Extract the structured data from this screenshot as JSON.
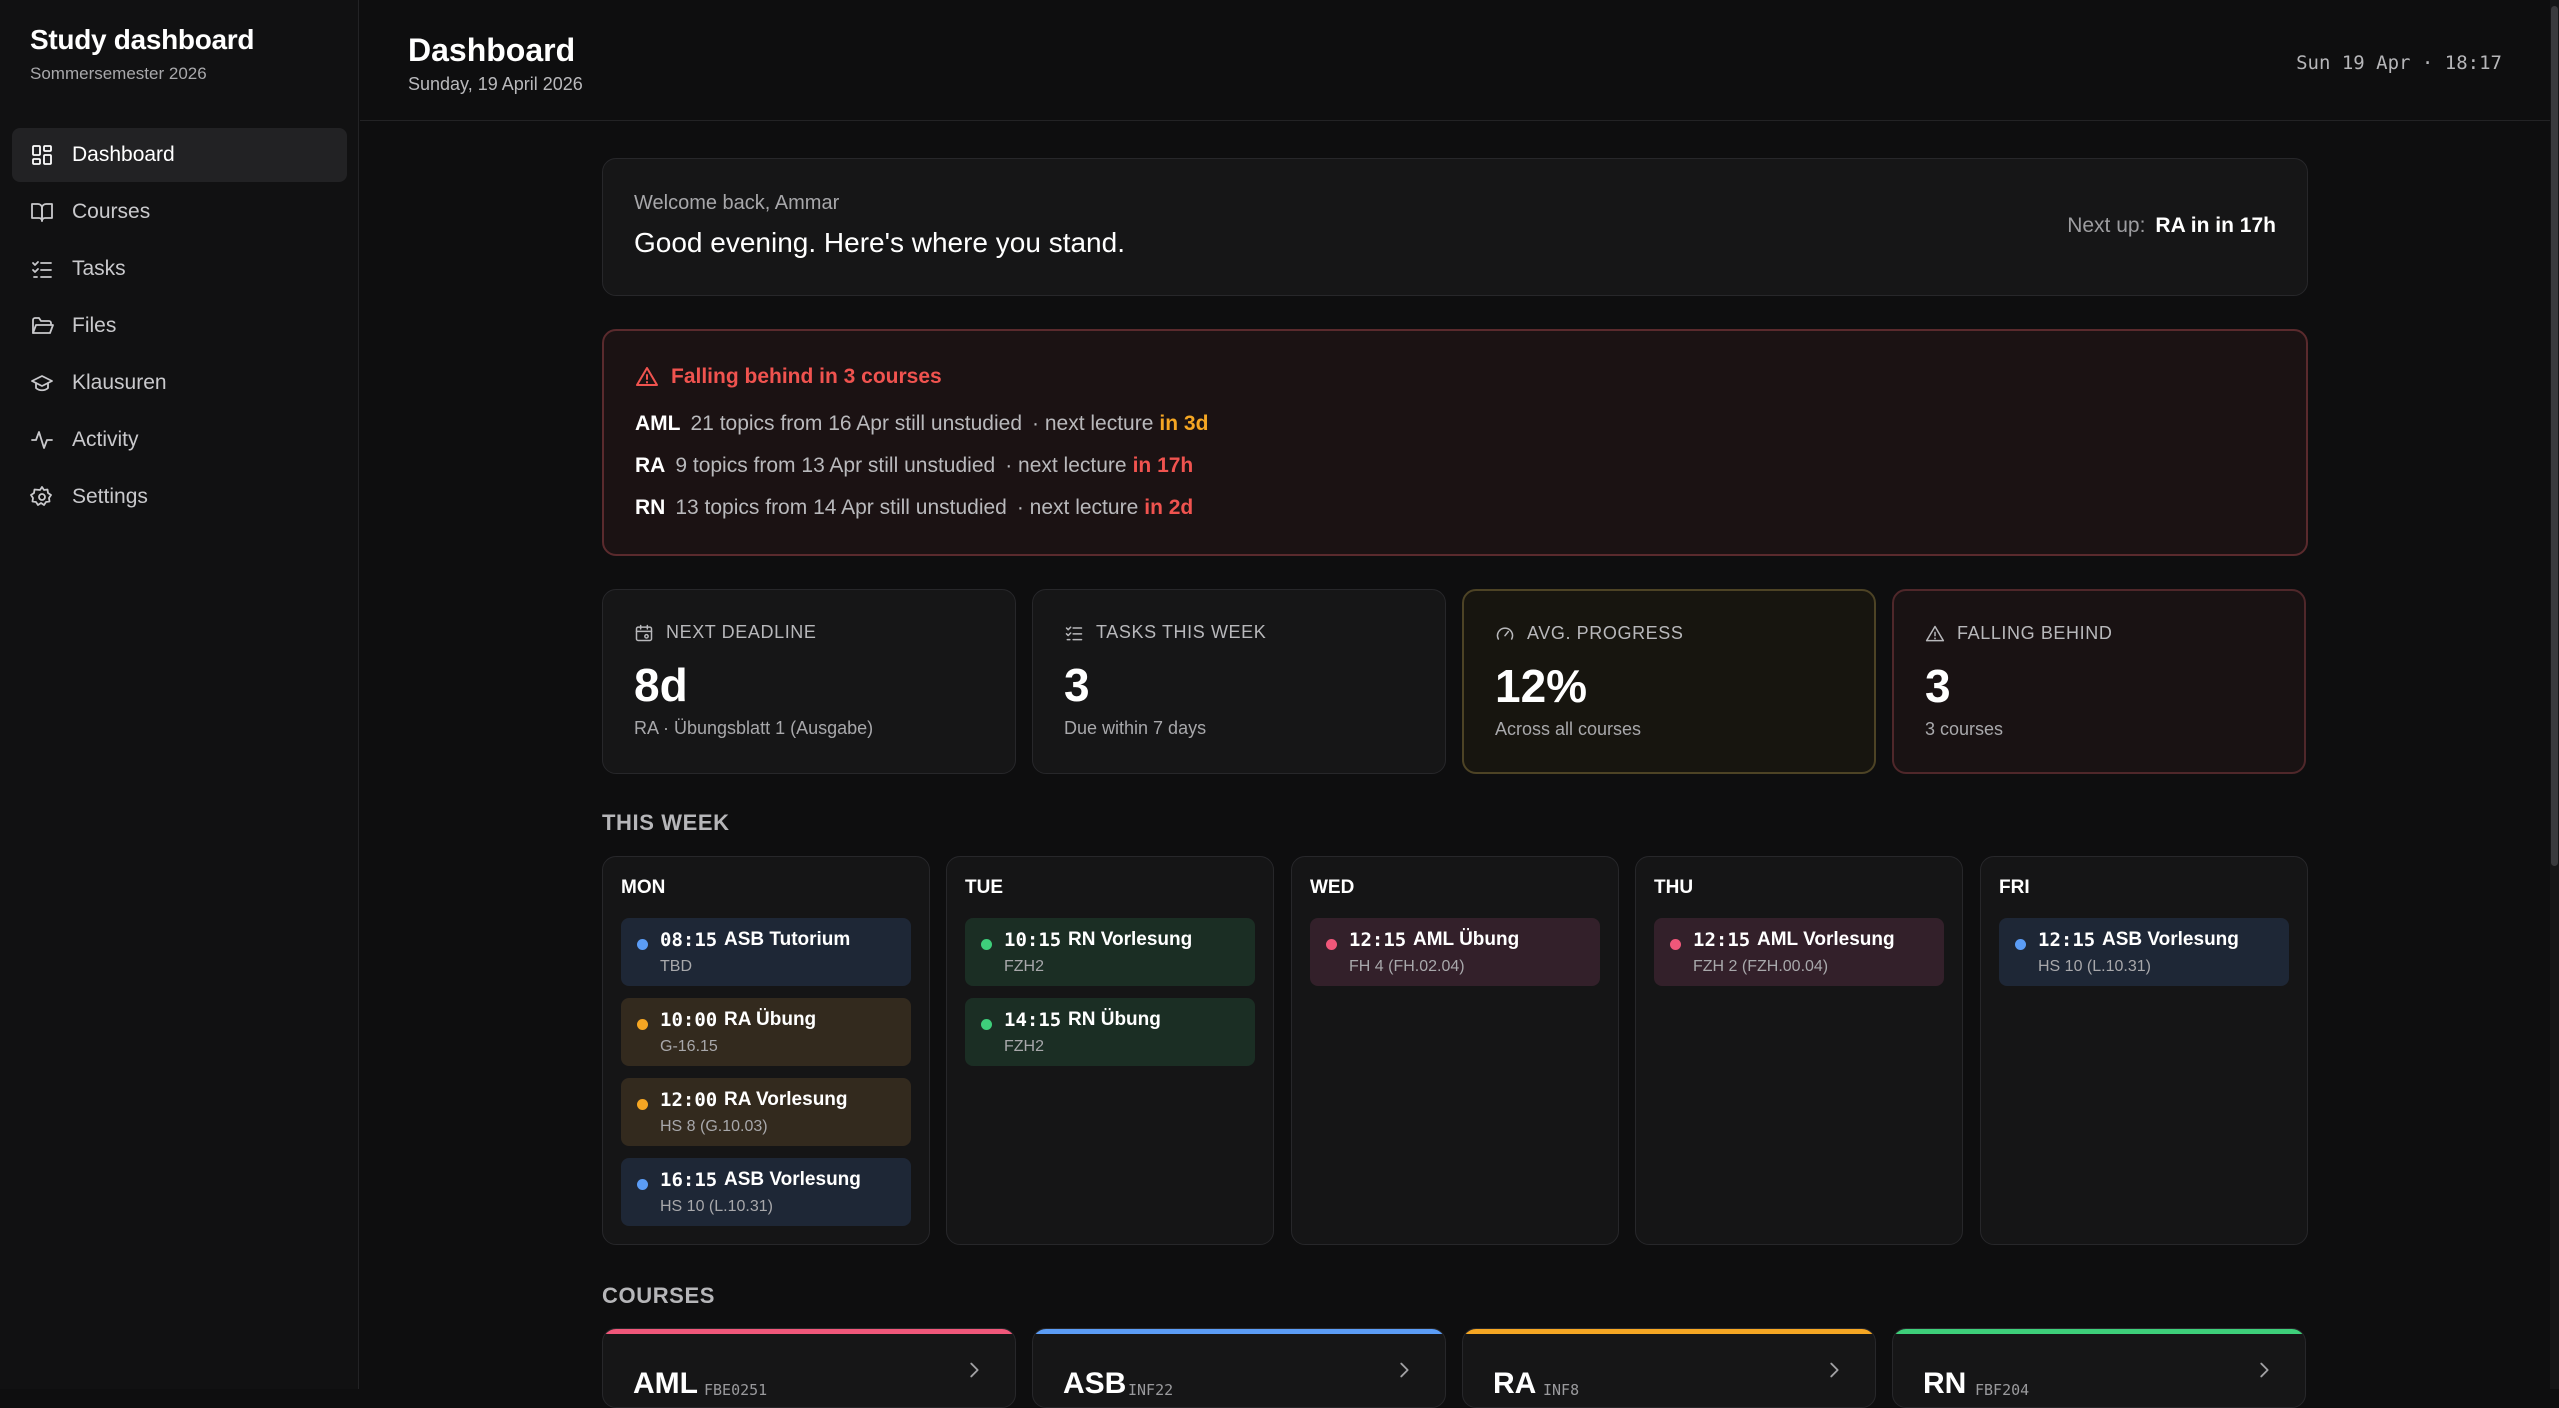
{
  "app": {
    "title": "Study dashboard",
    "semester": "Sommersemester 2026"
  },
  "sidebar": {
    "items": [
      {
        "label": "Dashboard",
        "icon": "dashboard-grid-icon",
        "active": true
      },
      {
        "label": "Courses",
        "icon": "book-icon"
      },
      {
        "label": "Tasks",
        "icon": "checklist-icon"
      },
      {
        "label": "Files",
        "icon": "folder-icon"
      },
      {
        "label": "Klausuren",
        "icon": "graduation-cap-icon"
      },
      {
        "label": "Activity",
        "icon": "activity-pulse-icon"
      },
      {
        "label": "Settings",
        "icon": "gear-icon"
      }
    ]
  },
  "header": {
    "title": "Dashboard",
    "date": "Sunday, 19 April 2026",
    "clock": "Sun 19 Apr · 18:17"
  },
  "welcome": {
    "greeting": "Welcome back, Ammar",
    "headline": "Good evening. Here's where you stand.",
    "next_label": "Next up:",
    "next_value": "RA in in 17h"
  },
  "alert": {
    "title": "Falling behind in 3 courses",
    "rows": [
      {
        "code": "AML",
        "text": "21 topics from 16 Apr still unstudied",
        "sep": "· next lecture",
        "when": "in 3d",
        "when_color": "#f5a623"
      },
      {
        "code": "RA",
        "text": "9 topics from 13 Apr still unstudied",
        "sep": "· next lecture",
        "when": "in 17h",
        "when_color": "#f0534f"
      },
      {
        "code": "RN",
        "text": "13 topics from 14 Apr still unstudied",
        "sep": "· next lecture",
        "when": "in 2d",
        "when_color": "#f0534f"
      }
    ]
  },
  "stats": [
    {
      "label": "NEXT DEADLINE",
      "value": "8d",
      "sub": "RA · Übungsblatt 1 (Ausgabe)",
      "icon": "calendar-icon"
    },
    {
      "label": "TASKS THIS WEEK",
      "value": "3",
      "sub": "Due within 7 days",
      "icon": "checklist-icon"
    },
    {
      "label": "AVG. PROGRESS",
      "value": "12%",
      "sub": "Across all courses",
      "icon": "gauge-icon"
    },
    {
      "label": "FALLING BEHIND",
      "value": "3",
      "sub": "3 courses",
      "icon": "warning-triangle-icon"
    }
  ],
  "week": {
    "title": "THIS WEEK",
    "days": [
      {
        "name": "MON",
        "events": [
          {
            "time": "08:15",
            "title": "ASB Tutorium",
            "loc": "TBD",
            "color": "#5b9cf5",
            "bg": "#1e2736"
          },
          {
            "time": "10:00",
            "title": "RA Übung",
            "loc": "G-16.15",
            "color": "#f5a623",
            "bg": "#332a1e"
          },
          {
            "time": "12:00",
            "title": "RA Vorlesung",
            "loc": "HS 8 (G.10.03)",
            "color": "#f5a623",
            "bg": "#332a1e"
          },
          {
            "time": "16:15",
            "title": "ASB Vorlesung",
            "loc": "HS 10 (L.10.31)",
            "color": "#5b9cf5",
            "bg": "#1e2736"
          }
        ]
      },
      {
        "name": "TUE",
        "events": [
          {
            "time": "10:15",
            "title": "RN Vorlesung",
            "loc": "FZH2",
            "color": "#3ecf7a",
            "bg": "#1b2e24"
          },
          {
            "time": "14:15",
            "title": "RN Übung",
            "loc": "FZH2",
            "color": "#3ecf7a",
            "bg": "#1b2e24"
          }
        ]
      },
      {
        "name": "WED",
        "events": [
          {
            "time": "12:15",
            "title": "AML Übung",
            "loc": "FH 4 (FH.02.04)",
            "color": "#f0577a",
            "bg": "#33202a"
          }
        ]
      },
      {
        "name": "THU",
        "events": [
          {
            "time": "12:15",
            "title": "AML Vorlesung",
            "loc": "FZH 2 (FZH.00.04)",
            "color": "#f0577a",
            "bg": "#33202a"
          }
        ]
      },
      {
        "name": "FRI",
        "events": [
          {
            "time": "12:15",
            "title": "ASB Vorlesung",
            "loc": "HS 10 (L.10.31)",
            "color": "#5b9cf5",
            "bg": "#1e2736"
          }
        ]
      }
    ]
  },
  "courses": {
    "title": "COURSES",
    "items": [
      {
        "code": "AML",
        "id": "FBE0251",
        "color": "#f0577a"
      },
      {
        "code": "ASB",
        "id": "INF22",
        "color": "#5b9cf5"
      },
      {
        "code": "RA",
        "id": "INF8",
        "color": "#f5a623"
      },
      {
        "code": "RN",
        "id": "FBF204",
        "color": "#3ecf7a"
      }
    ]
  }
}
